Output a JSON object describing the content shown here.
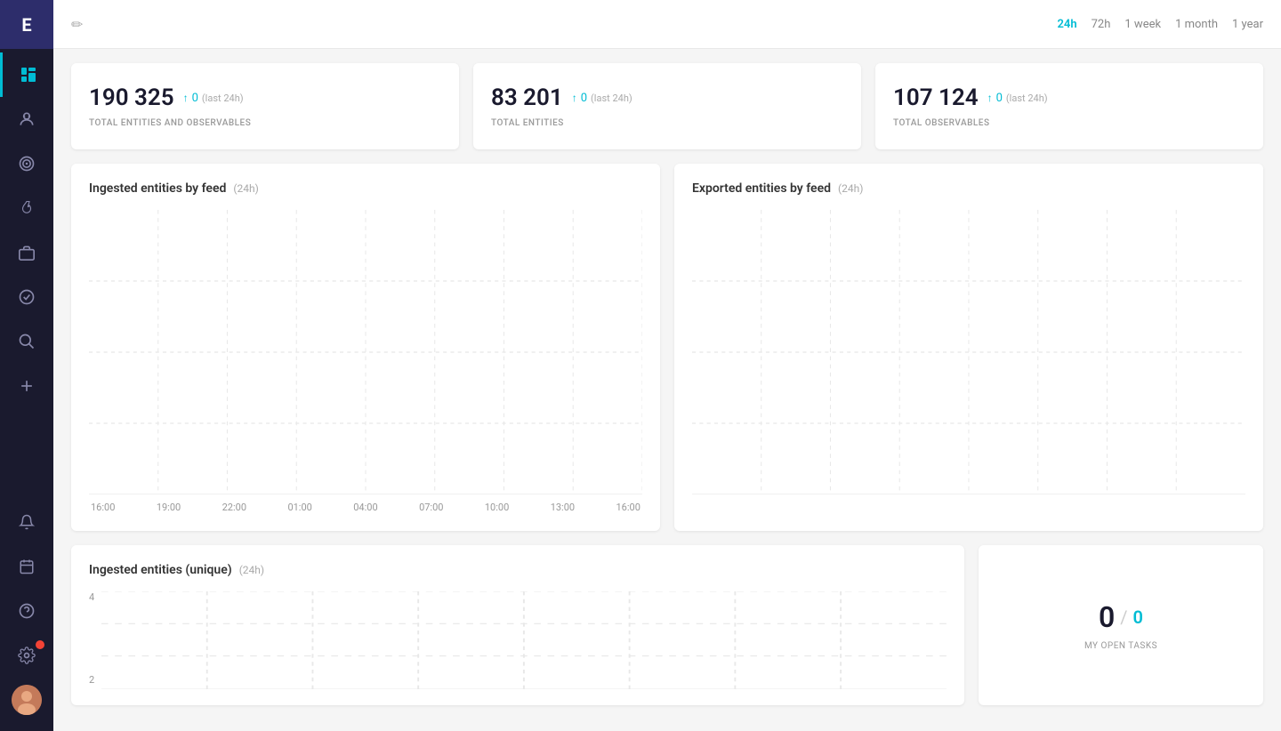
{
  "sidebar": {
    "logo": "E",
    "items": [
      {
        "id": "dashboard",
        "icon": "📊",
        "active": true
      },
      {
        "id": "robot",
        "icon": "🤖",
        "active": false
      },
      {
        "id": "target",
        "icon": "🎯",
        "active": false
      },
      {
        "id": "flame",
        "icon": "🔥",
        "active": false
      },
      {
        "id": "briefcase",
        "icon": "💼",
        "active": false
      },
      {
        "id": "check",
        "icon": "✓",
        "active": false
      },
      {
        "id": "search",
        "icon": "🔍",
        "active": false
      },
      {
        "id": "plus",
        "icon": "+",
        "active": false
      }
    ],
    "bottom_items": [
      {
        "id": "bell",
        "icon": "🔔",
        "badge": true
      },
      {
        "id": "calendar",
        "icon": "📅"
      },
      {
        "id": "help",
        "icon": "?"
      },
      {
        "id": "settings",
        "icon": "⚙",
        "badge": true
      }
    ]
  },
  "topbar": {
    "edit_label": "✏",
    "time_filters": [
      {
        "label": "24h",
        "active": true
      },
      {
        "label": "72h",
        "active": false
      },
      {
        "label": "1 week",
        "active": false
      },
      {
        "label": "1 month",
        "active": false
      },
      {
        "label": "1 year",
        "active": false
      }
    ]
  },
  "stats": [
    {
      "number": "190 325",
      "change": "0",
      "period": "(last 24h)",
      "label": "TOTAL ENTITIES AND OBSERVABLES"
    },
    {
      "number": "83 201",
      "change": "0",
      "period": "(last 24h)",
      "label": "TOTAL ENTITIES"
    },
    {
      "number": "107 124",
      "change": "0",
      "period": "(last 24h)",
      "label": "TOTAL OBSERVABLES"
    }
  ],
  "charts": {
    "ingested": {
      "title": "Ingested entities by feed",
      "subtitle": "(24h)",
      "xaxis": [
        "16:00",
        "19:00",
        "22:00",
        "01:00",
        "04:00",
        "07:00",
        "10:00",
        "13:00",
        "16:00"
      ]
    },
    "exported": {
      "title": "Exported entities by feed",
      "subtitle": "(24h)"
    }
  },
  "ingested_unique": {
    "title": "Ingested entities (unique)",
    "subtitle": "(24h)",
    "yaxis": [
      "4",
      "2"
    ]
  },
  "tasks": {
    "main": "0",
    "total": "0",
    "label": "MY OPEN TASKS"
  }
}
